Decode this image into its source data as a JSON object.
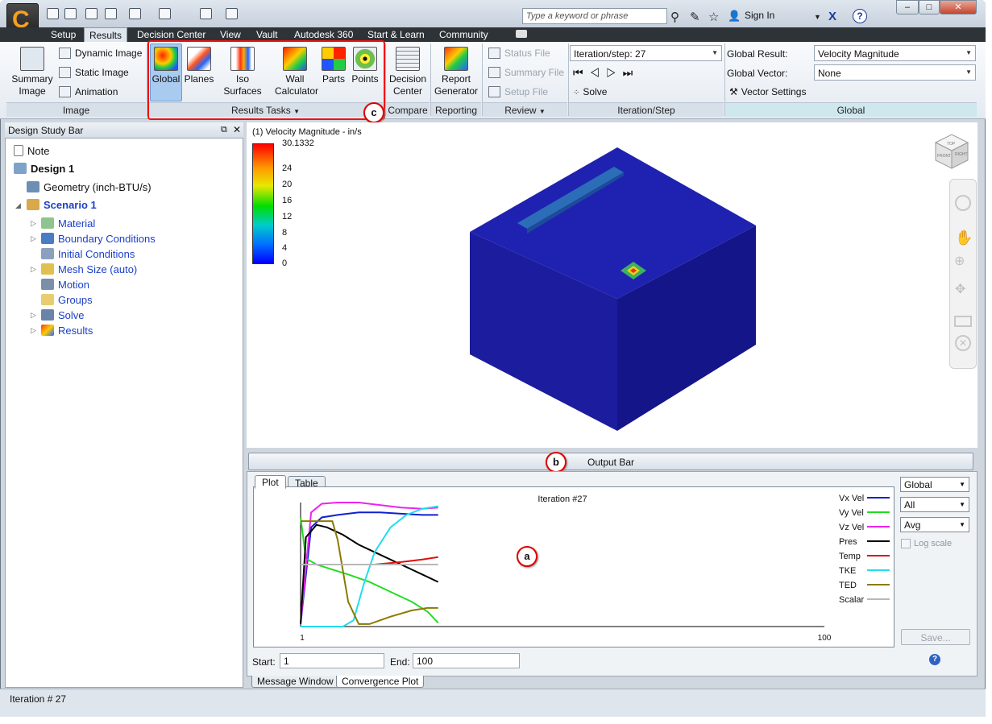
{
  "window": {
    "controls": [
      "–",
      "□",
      "✕"
    ]
  },
  "search": {
    "placeholder": "Type a keyword or phrase"
  },
  "header": {
    "sign_in": "Sign In"
  },
  "menu_tabs": [
    "Setup",
    "Results",
    "Decision Center",
    "View",
    "Vault",
    "Autodesk 360",
    "Start & Learn",
    "Community"
  ],
  "ribbon": {
    "image": {
      "summary_image": "Summary Image",
      "dynamic_image": "Dynamic Image",
      "static_image": "Static Image",
      "animation": "Animation",
      "label": "Image"
    },
    "results_tasks": {
      "global": "Global",
      "planes": "Planes",
      "iso_surfaces": "Iso Surfaces",
      "wall_calculator": "Wall Calculator",
      "parts": "Parts",
      "points": "Points",
      "label": "Results Tasks"
    },
    "compare": {
      "decision_center": "Decision Center",
      "label": "Compare"
    },
    "reporting": {
      "report_generator": "Report Generator",
      "label": "Reporting"
    },
    "review": {
      "status_file": "Status File",
      "summary_file": "Summary File",
      "setup_file": "Setup File",
      "label": "Review"
    },
    "iteration": {
      "combo": "Iteration/step: 27",
      "solve": "Solve",
      "label": "Iteration/Step"
    },
    "global": {
      "result_label": "Global Result:",
      "result_value": "Velocity Magnitude",
      "vector_label": "Global Vector:",
      "vector_value": "None",
      "vector_settings": "Vector Settings",
      "label": "Global"
    }
  },
  "callouts": {
    "a": "a",
    "b": "b",
    "c": "c"
  },
  "design_study_bar": {
    "title": "Design Study Bar",
    "items": [
      {
        "label": "Note"
      },
      {
        "label": "Design 1"
      },
      {
        "label": "Geometry (inch-BTU/s)"
      },
      {
        "label": "Scenario 1"
      },
      {
        "label": "Material"
      },
      {
        "label": "Boundary Conditions"
      },
      {
        "label": "Initial Conditions"
      },
      {
        "label": "Mesh Size (auto)"
      },
      {
        "label": "Motion"
      },
      {
        "label": "Groups"
      },
      {
        "label": "Solve"
      },
      {
        "label": "Results"
      }
    ]
  },
  "view": {
    "legend_title": "(1) Velocity Magnitude - in/s",
    "legend_ticks": [
      "30.1332",
      "24",
      "20",
      "16",
      "12",
      "8",
      "4",
      "0"
    ],
    "cube_faces": {
      "top": "TOP",
      "front": "FRONT",
      "right": "RIGHT"
    },
    "colors": {
      "box_front": "#1c1c9e",
      "box_side": "#15158a",
      "box_top": "#1f22b0"
    }
  },
  "output_bar": {
    "title": "Output Bar",
    "tabs": [
      "Plot",
      "Table"
    ],
    "bottom_tabs": [
      "Message Window",
      "Convergence Plot"
    ],
    "start_label": "Start:",
    "start_value": "1",
    "end_label": "End:",
    "end_value": "100",
    "combos": [
      "Global",
      "All",
      "Avg"
    ],
    "log_scale": "Log scale",
    "save": "Save...",
    "help": "?"
  },
  "chart_data": {
    "type": "line",
    "title": "Iteration #27",
    "xlim": [
      1,
      100
    ],
    "x_tick_labels": [
      "1",
      "100"
    ],
    "series": [
      {
        "name": "Vx Vel",
        "color": "#1020d0",
        "x": [
          1,
          3,
          5,
          8,
          12,
          16,
          20,
          24,
          27
        ],
        "y": [
          0.02,
          0.8,
          0.88,
          0.9,
          0.92,
          0.92,
          0.91,
          0.9,
          0.9
        ]
      },
      {
        "name": "Vy Vel",
        "color": "#22dd22",
        "x": [
          1,
          2,
          4,
          7,
          10,
          14,
          18,
          22,
          25,
          27
        ],
        "y": [
          0.88,
          0.55,
          0.5,
          0.46,
          0.42,
          0.36,
          0.28,
          0.2,
          0.12,
          0.03
        ]
      },
      {
        "name": "Vz Vel",
        "color": "#ee22ee",
        "x": [
          1,
          3,
          5,
          8,
          12,
          16,
          20,
          24,
          27
        ],
        "y": [
          0.02,
          0.92,
          0.99,
          1.0,
          1.0,
          0.98,
          0.96,
          0.95,
          0.96
        ]
      },
      {
        "name": "Pres",
        "color": "#000000",
        "x": [
          1,
          2,
          4,
          6,
          9,
          12,
          16,
          20,
          24,
          27
        ],
        "y": [
          0.02,
          0.72,
          0.82,
          0.8,
          0.74,
          0.66,
          0.58,
          0.5,
          0.42,
          0.36
        ]
      },
      {
        "name": "Temp",
        "color": "#dd1111",
        "x": [
          1,
          5,
          10,
          15,
          20,
          24,
          27
        ],
        "y": [
          0.5,
          0.5,
          0.5,
          0.5,
          0.52,
          0.54,
          0.56
        ]
      },
      {
        "name": "TKE",
        "color": "#22ddee",
        "x": [
          1,
          9,
          11,
          13,
          15,
          18,
          21,
          24,
          27
        ],
        "y": [
          0.0,
          0.0,
          0.05,
          0.35,
          0.6,
          0.8,
          0.9,
          0.95,
          0.97
        ]
      },
      {
        "name": "TED",
        "color": "#8b7a00",
        "x": [
          1,
          2,
          7,
          8,
          10,
          12,
          14,
          18,
          22,
          25,
          27
        ],
        "y": [
          0.85,
          0.85,
          0.85,
          0.7,
          0.2,
          0.02,
          0.02,
          0.08,
          0.13,
          0.15,
          0.15
        ]
      },
      {
        "name": "Scalar",
        "color": "#b8b8b8",
        "x": [
          1,
          27
        ],
        "y": [
          0.5,
          0.5
        ]
      }
    ]
  },
  "status": {
    "text": "Iteration # 27"
  }
}
